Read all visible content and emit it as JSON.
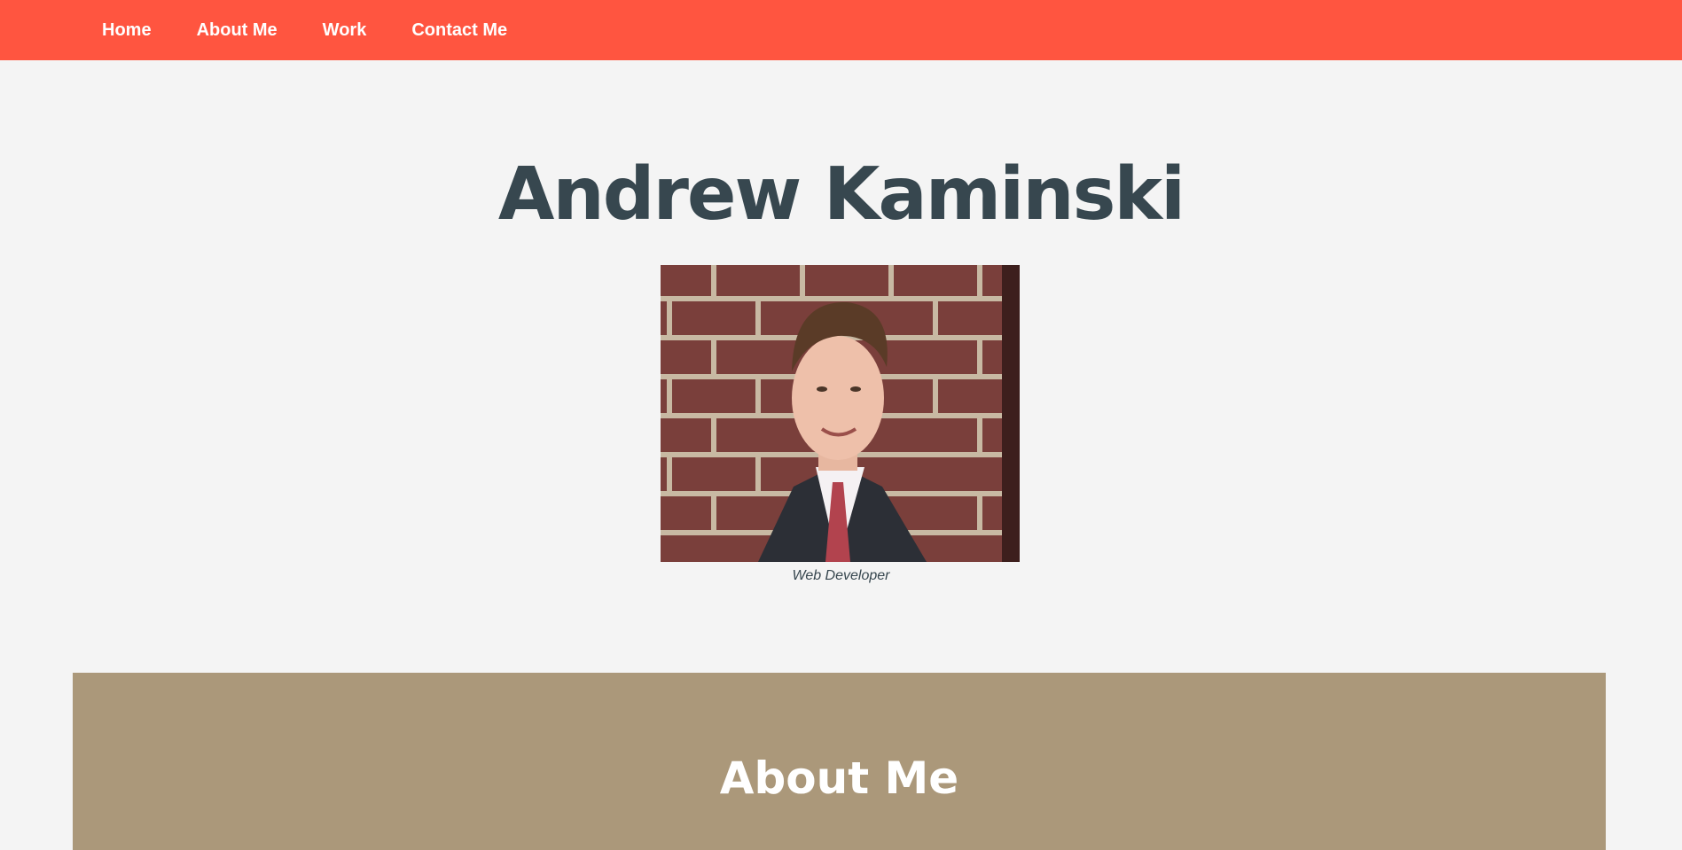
{
  "nav": {
    "items": [
      {
        "label": "Home"
      },
      {
        "label": "About Me"
      },
      {
        "label": "Work"
      },
      {
        "label": "Contact Me"
      }
    ]
  },
  "hero": {
    "title": "Andrew Kaminski",
    "caption": "Web Developer"
  },
  "about": {
    "title": "About Me"
  },
  "colors": {
    "navbar": "#ff5540",
    "page_background": "#f4f4f4",
    "title_text": "#37474f",
    "about_background": "#ab987a"
  }
}
